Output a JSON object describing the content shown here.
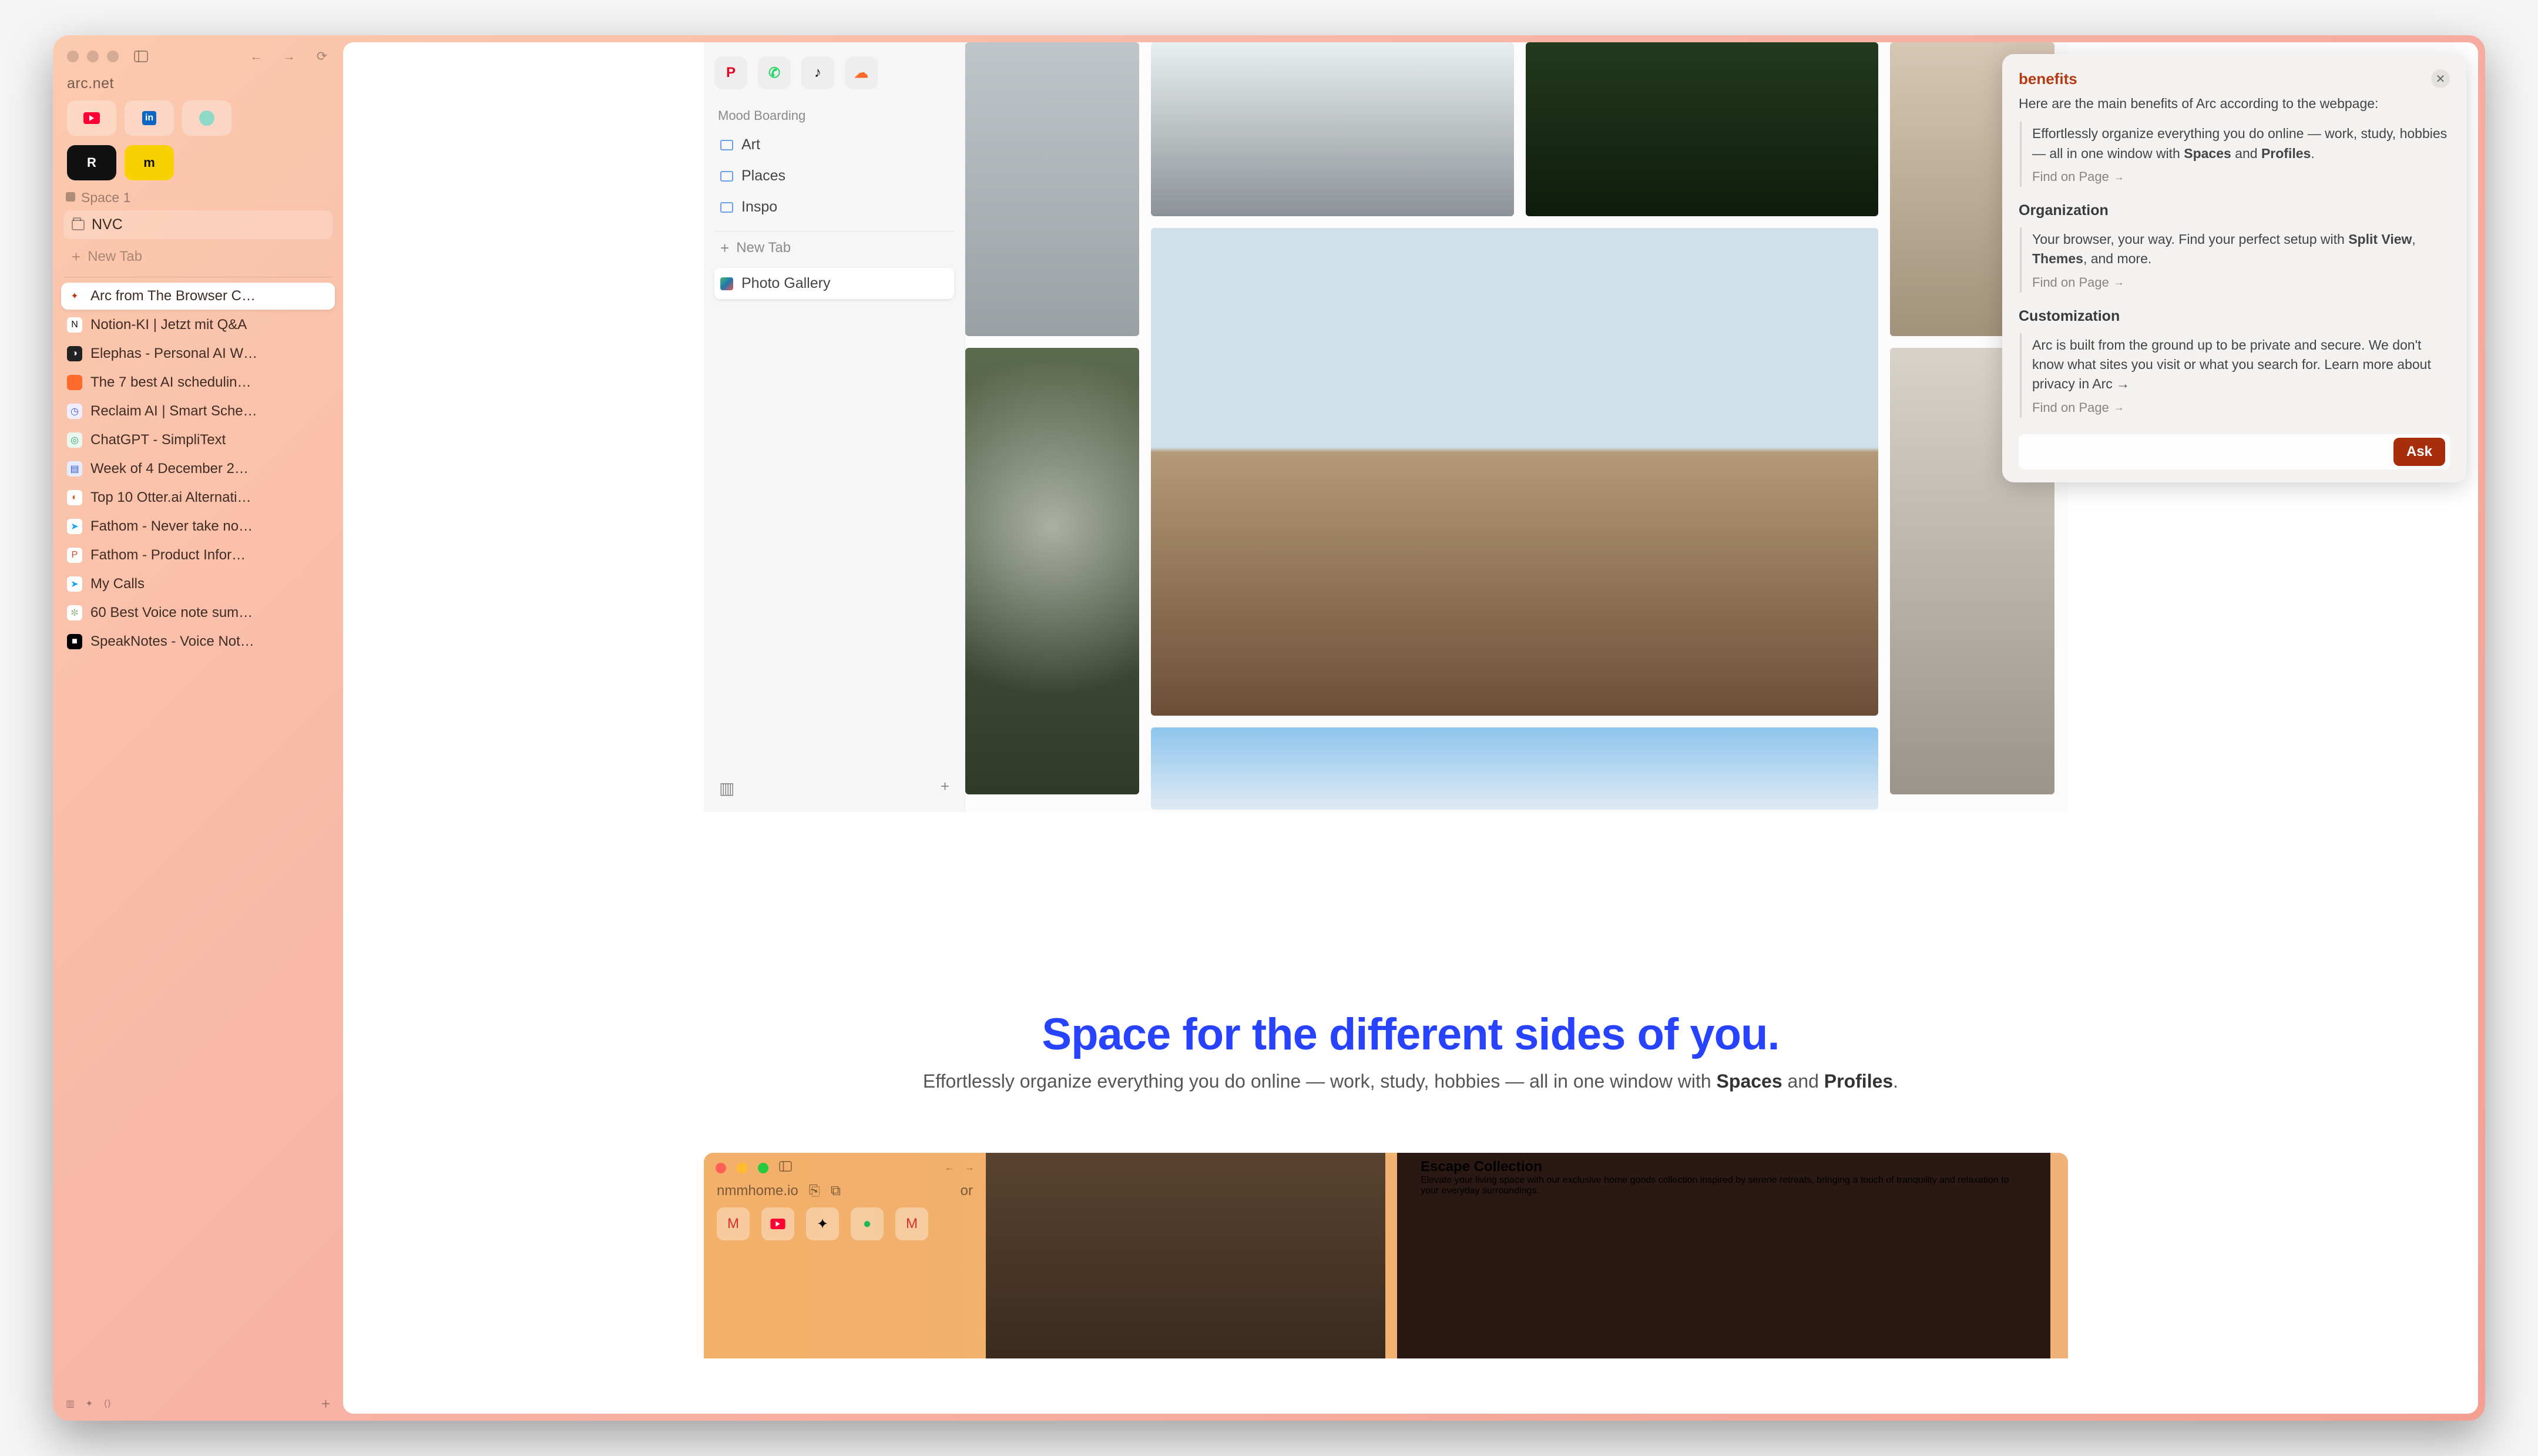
{
  "url": "arc.net",
  "toolbar": {
    "sidebar_toggle": "sidebar",
    "back": "back",
    "forward": "forward",
    "reload": "reload"
  },
  "pinned": [
    {
      "name": "youtube",
      "color": "#ff0033"
    },
    {
      "name": "linkedin",
      "color": "#0a66c2"
    },
    {
      "name": "app-teal",
      "color": "#8fd9c8"
    },
    {
      "name": "r-app",
      "label": "R",
      "bg": "#111",
      "fg": "#fff"
    },
    {
      "name": "m-app",
      "label": "m",
      "bg": "#f7d100",
      "fg": "#111"
    }
  ],
  "space_label": "Space 1",
  "folder": "NVC",
  "newtab": "New Tab",
  "tabs": [
    {
      "label": "Arc from The Browser C…",
      "active": true,
      "icon": "✦",
      "ibg": "#fff",
      "ic": "#b53b12"
    },
    {
      "label": "Notion-KI | Jetzt mit Q&A",
      "icon": "N",
      "ibg": "#fff",
      "ic": "#111"
    },
    {
      "label": "Elephas - Personal AI W…",
      "icon": "◑",
      "ibg": "#222",
      "ic": "#fff"
    },
    {
      "label": "The 7 best AI schedulin…",
      "icon": "",
      "ibg": "#ff6a2b",
      "ic": "#fff"
    },
    {
      "label": "Reclaim AI | Smart Sche…",
      "icon": "◷",
      "ibg": "#eef",
      "ic": "#4455dd"
    },
    {
      "label": "ChatGPT - SimpliText",
      "icon": "◎",
      "ibg": "#e9f7ef",
      "ic": "#43a074"
    },
    {
      "label": "Week of 4 December 2…",
      "icon": "▤",
      "ibg": "#e6ecff",
      "ic": "#3355cc"
    },
    {
      "label": "Top 10 Otter.ai Alternati…",
      "icon": "◐",
      "ibg": "#fff",
      "ic": "#e05a18"
    },
    {
      "label": "Fathom - Never take no…",
      "icon": "➤",
      "ibg": "#fff",
      "ic": "#1aa3ff"
    },
    {
      "label": "Fathom - Product Infor…",
      "icon": "P",
      "ibg": "#fff",
      "ic": "#e0452a"
    },
    {
      "label": "My Calls",
      "icon": "➤",
      "ibg": "#fff",
      "ic": "#1aa3ff"
    },
    {
      "label": "60 Best Voice note sum…",
      "icon": "✼",
      "ibg": "#fff",
      "ic": "#9bb98f"
    },
    {
      "label": "SpeakNotes - Voice Not…",
      "icon": "■",
      "ibg": "#000",
      "ic": "#fff"
    }
  ],
  "inset": {
    "apps": [
      {
        "name": "pinterest",
        "color": "#e60023",
        "glyph": "P"
      },
      {
        "name": "whatsapp",
        "color": "#25d366",
        "glyph": "✆"
      },
      {
        "name": "tiktok",
        "color": "#111",
        "glyph": "♪"
      },
      {
        "name": "soundcloud",
        "color": "#ff6a2b",
        "glyph": "☁"
      }
    ],
    "section": "Mood Boarding",
    "items": [
      "Art",
      "Places",
      "Inspo"
    ],
    "newtab": "New Tab",
    "active": "Photo Gallery"
  },
  "hero": {
    "title": "Space for the different sides of you.",
    "sub_pre": "Effortlessly organize everything you do online — work, study, hobbies — all in one window with ",
    "sub_b1": "Spaces",
    "sub_mid": " and ",
    "sub_b2": "Profiles",
    "sub_post": "."
  },
  "inset2": {
    "url": "nmmhome.io",
    "or": "or",
    "title": "Escape Collection",
    "body": "Elevate your living space with our exclusive home goods collection inspired by serene retreats, bringing a touch of tranquility and relaxation to your everyday surroundings."
  },
  "panel": {
    "title": "benefits",
    "intro": "Here are the main benefits of Arc according to the webpage:",
    "b1_pre": "Effortlessly organize everything you do online — work, study, hobbies — all in one window with ",
    "b1_s": "Spaces",
    "b1_mid": " and ",
    "b1_p": "Profiles",
    "b1_post": ".",
    "find": "Find on Page",
    "s2": "Organization",
    "b2_pre": "Your browser, your way. Find your perfect setup with ",
    "b2_sv": "Split View",
    "b2_mid": ", ",
    "b2_th": "Themes",
    "b2_post": ", and more.",
    "s3": "Customization",
    "b3": "Arc is built from the ground up to be private and secure. We don't know what sites you visit or what you search for. Learn more about privacy in Arc →",
    "ask_placeholder": "",
    "ask": "Ask"
  }
}
